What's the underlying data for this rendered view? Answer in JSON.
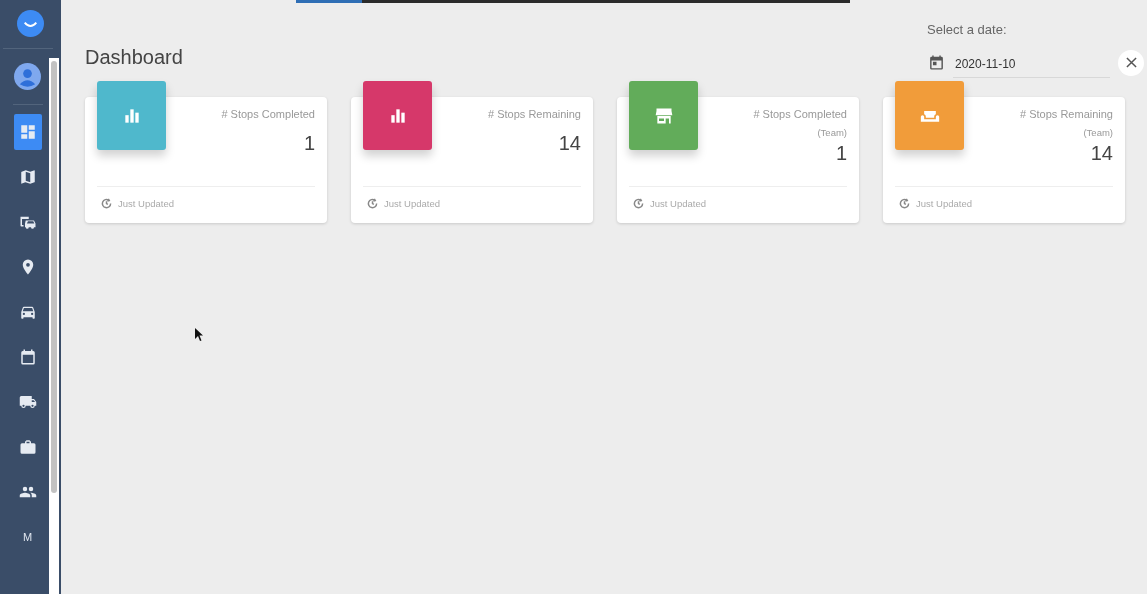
{
  "progress": {
    "level": 0.12
  },
  "sidebar": {
    "items": [
      {
        "kind": "icon",
        "selected": true
      },
      {
        "kind": "icon",
        "selected": false
      },
      {
        "kind": "icon",
        "selected": false
      },
      {
        "kind": "icon",
        "selected": false
      },
      {
        "kind": "icon",
        "selected": false
      },
      {
        "kind": "icon",
        "selected": false
      },
      {
        "kind": "icon",
        "selected": false
      },
      {
        "kind": "icon",
        "selected": false
      },
      {
        "kind": "icon",
        "selected": false
      },
      {
        "kind": "text",
        "label": "M",
        "selected": false
      }
    ]
  },
  "page_title": "Dashboard",
  "date_picker": {
    "label": "Select a date:",
    "value": "2020-11-10"
  },
  "cards": [
    {
      "color": "#4fb8cc",
      "title": "# Stops Completed",
      "value": "1",
      "footer": "Just Updated"
    },
    {
      "color": "#d6386a",
      "title": "# Stops Remaining",
      "value": "14",
      "footer": "Just Updated"
    },
    {
      "color": "#62ac5a",
      "title": "# Stops Completed",
      "subtitle": "(Team)",
      "value": "1",
      "footer": "Just Updated"
    },
    {
      "color": "#f19c3a",
      "title": "# Stops Remaining",
      "subtitle": "(Team)",
      "value": "14",
      "footer": "Just Updated"
    }
  ]
}
